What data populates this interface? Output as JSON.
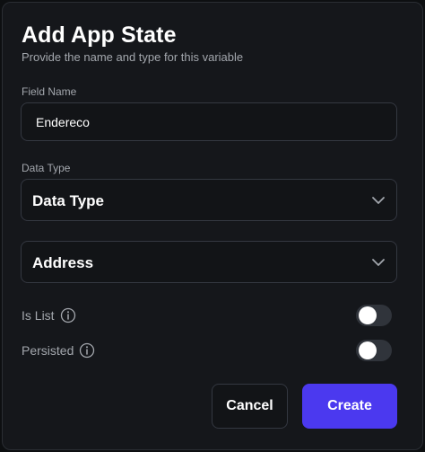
{
  "dialog": {
    "title": "Add App State",
    "subtitle": "Provide the name and type for this variable"
  },
  "field_name": {
    "label": "Field Name",
    "value": "Endereco"
  },
  "data_type": {
    "label": "Data Type",
    "selected": "Data Type"
  },
  "sub_type": {
    "selected": "Address"
  },
  "is_list": {
    "label": "Is List",
    "enabled": false
  },
  "persisted": {
    "label": "Persisted",
    "enabled": false
  },
  "actions": {
    "cancel_label": "Cancel",
    "create_label": "Create"
  },
  "colors": {
    "primary": "#4b39ef",
    "background": "#15171b"
  },
  "icons": {
    "chevron": "chevron-down-icon",
    "info": "info-icon"
  }
}
